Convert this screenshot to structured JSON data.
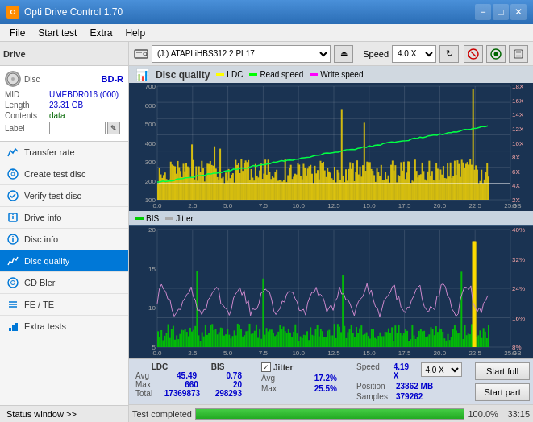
{
  "titlebar": {
    "title": "Opti Drive Control 1.70",
    "icon_label": "O",
    "min_btn": "−",
    "max_btn": "□",
    "close_btn": "✕"
  },
  "menubar": {
    "items": [
      "File",
      "Start test",
      "Extra",
      "Help"
    ]
  },
  "drive": {
    "label": "Drive",
    "drive_value": "(J:)  ATAPI iHBS312  2 PL17",
    "speed_label": "Speed",
    "speed_value": "4.0 X"
  },
  "disc": {
    "type": "BD-R",
    "mid_label": "MID",
    "mid_value": "UMEBDR016 (000)",
    "length_label": "Length",
    "length_value": "23.31 GB",
    "contents_label": "Contents",
    "contents_value": "data",
    "label_label": "Label"
  },
  "nav": {
    "items": [
      {
        "id": "transfer-rate",
        "label": "Transfer rate",
        "icon": "chart"
      },
      {
        "id": "create-test-disc",
        "label": "Create test disc",
        "icon": "disc"
      },
      {
        "id": "verify-test-disc",
        "label": "Verify test disc",
        "icon": "check"
      },
      {
        "id": "drive-info",
        "label": "Drive info",
        "icon": "info"
      },
      {
        "id": "disc-info",
        "label": "Disc info",
        "icon": "disc-info"
      },
      {
        "id": "disc-quality",
        "label": "Disc quality",
        "icon": "quality",
        "active": true
      },
      {
        "id": "cd-bler",
        "label": "CD Bler",
        "icon": "cd"
      },
      {
        "id": "fe-te",
        "label": "FE / TE",
        "icon": "fe"
      },
      {
        "id": "extra-tests",
        "label": "Extra tests",
        "icon": "extra"
      }
    ]
  },
  "chart": {
    "title": "Disc quality",
    "upper_legend": {
      "ldc": "LDC",
      "read": "Read speed",
      "write": "Write speed"
    },
    "upper_y_left": [
      "700",
      "600",
      "500",
      "400",
      "300",
      "200",
      "100"
    ],
    "upper_y_right": [
      "18X",
      "16X",
      "14X",
      "12X",
      "10X",
      "8X",
      "6X",
      "4X",
      "2X"
    ],
    "upper_x": [
      "0.0",
      "2.5",
      "5.0",
      "7.5",
      "10.0",
      "12.5",
      "15.0",
      "17.5",
      "20.0",
      "22.5",
      "25.0 GB"
    ],
    "lower_legend": {
      "bis": "BIS",
      "jitter": "Jitter"
    },
    "lower_y_left": [
      "20",
      "15",
      "10",
      "5"
    ],
    "lower_y_right": [
      "40%",
      "32%",
      "24%",
      "16%",
      "8%"
    ],
    "lower_x": [
      "0.0",
      "2.5",
      "5.0",
      "7.5",
      "10.0",
      "12.5",
      "15.0",
      "17.5",
      "20.0",
      "22.5",
      "25.0 GB"
    ]
  },
  "stats": {
    "ldc_label": "LDC",
    "bis_label": "BIS",
    "jitter_label": "Jitter",
    "avg_label": "Avg",
    "max_label": "Max",
    "total_label": "Total",
    "ldc_avg": "45.49",
    "ldc_max": "660",
    "ldc_total": "17369873",
    "bis_avg": "0.78",
    "bis_max": "20",
    "bis_total": "298293",
    "jitter_avg": "17.2%",
    "jitter_max": "25.5%",
    "jitter_checked": true,
    "speed_label": "Speed",
    "speed_value": "4.19 X",
    "speed_select": "4.0 X",
    "position_label": "Position",
    "position_value": "23862 MB",
    "samples_label": "Samples",
    "samples_value": "379262",
    "start_full_btn": "Start full",
    "start_part_btn": "Start part"
  },
  "progress": {
    "percent": "100.0%",
    "fill_width": "100",
    "time": "33:15"
  },
  "status": {
    "label": "Status window >>",
    "status_text": "Test completed"
  }
}
